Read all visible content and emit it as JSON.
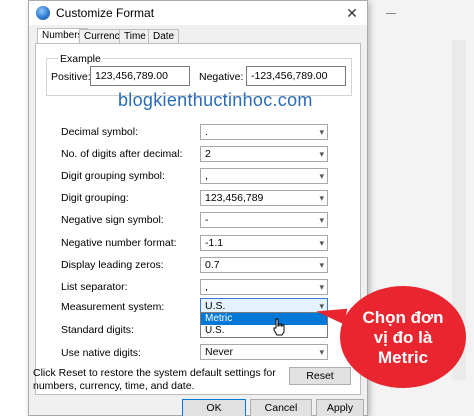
{
  "dialog": {
    "title": "Customize Format",
    "close_glyph": "✕"
  },
  "tabs": [
    {
      "label": "Numbers"
    },
    {
      "label": "Currency"
    },
    {
      "label": "Time"
    },
    {
      "label": "Date"
    }
  ],
  "example": {
    "group_title": "Example",
    "positive_label": "Positive:",
    "positive_value": "123,456,789.00",
    "negative_label": "Negative:",
    "negative_value": "-123,456,789.00"
  },
  "watermark": "blogkienthuctinhoc.com",
  "settings": [
    {
      "label": "Decimal symbol:",
      "value": "."
    },
    {
      "label": "No. of digits after decimal:",
      "value": "2"
    },
    {
      "label": "Digit grouping symbol:",
      "value": ","
    },
    {
      "label": "Digit grouping:",
      "value": "123,456,789"
    },
    {
      "label": "Negative sign symbol:",
      "value": "-"
    },
    {
      "label": "Negative number format:",
      "value": "-1.1"
    },
    {
      "label": "Display leading zeros:",
      "value": "0.7"
    },
    {
      "label": "List separator:",
      "value": ","
    },
    {
      "label": "Measurement system:",
      "value": "U.S."
    },
    {
      "label": "Standard digits:",
      "value": ""
    },
    {
      "label": "Use native digits:",
      "value": "Never"
    }
  ],
  "dropdown": {
    "options": [
      "Metric",
      "U.S."
    ],
    "highlighted": "Metric"
  },
  "callout": {
    "line1": "Chọn đơn",
    "line2": "vị đo là",
    "line3": "Metric",
    "color": "#e9262f"
  },
  "footer": {
    "reset_hint": "Click Reset to restore the system default settings for numbers, currency, time, and date.",
    "reset_label": "Reset",
    "ok_label": "OK",
    "cancel_label": "Cancel",
    "apply_label": "Apply"
  },
  "colors": {
    "accent": "#0078d7",
    "watermark": "#2a6bb8"
  }
}
